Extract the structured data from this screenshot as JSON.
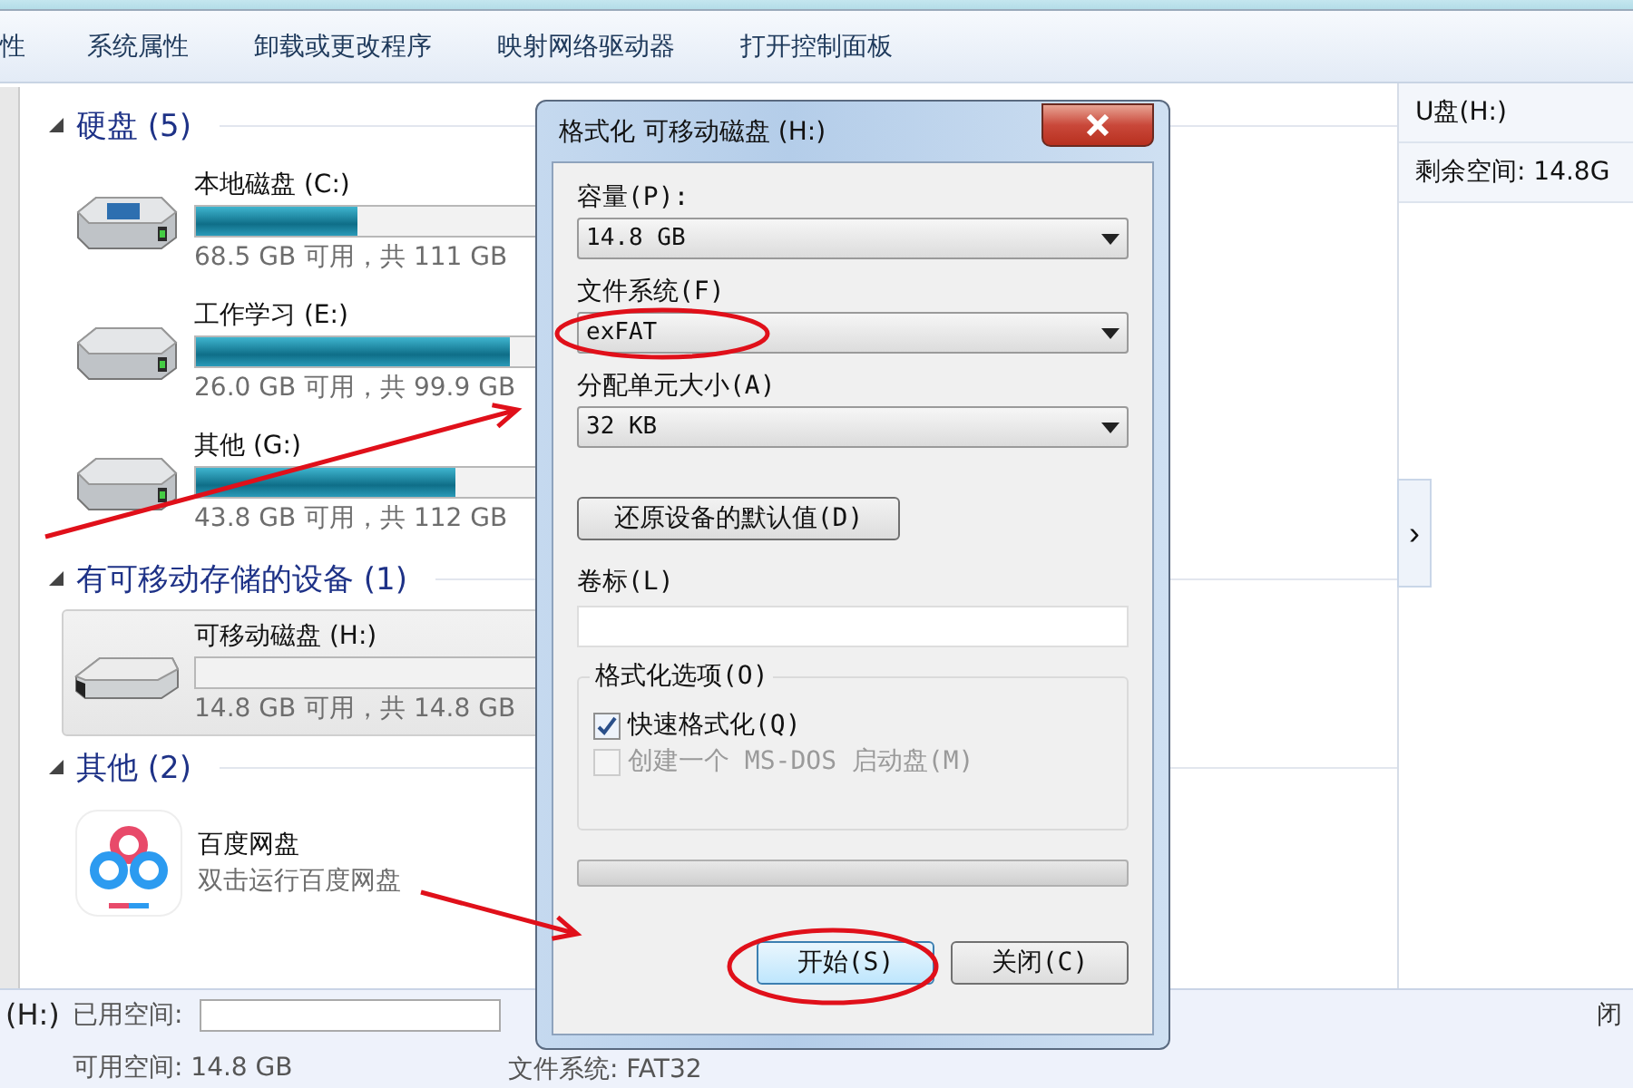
{
  "toolbar": {
    "items": [
      "性",
      "系统属性",
      "卸载或更改程序",
      "映射网络驱动器",
      "打开控制面板"
    ]
  },
  "sections": [
    {
      "title": "硬盘 (5)",
      "expanded": true,
      "items": [
        {
          "kind": "system_drive",
          "name": "本地磁盘 (C:)",
          "level": 0.38,
          "reading": "68.5 GB 可用，共 111 GB",
          "selected": false
        },
        {
          "kind": "drive",
          "name": "工作学习 (E:)",
          "level": 0.74,
          "reading": "26.0 GB 可用，共 99.9 GB",
          "selected": false
        },
        {
          "kind": "drive",
          "name": "其他 (G:)",
          "level": 0.61,
          "reading": "43.8 GB 可用，共 112 GB",
          "selected": false
        }
      ]
    },
    {
      "title": "有可移动存储的设备 (1)",
      "expanded": true,
      "items": [
        {
          "kind": "removable_drive",
          "name": "可移动磁盘 (H:)",
          "level": 0,
          "reading": "14.8 GB 可用，共 14.8 GB",
          "selected": true
        }
      ]
    },
    {
      "title": "其他 (2)",
      "expanded": true,
      "items": [
        {
          "kind": "app",
          "name": "百度网盘",
          "reading": "双击运行百度网盘",
          "selected": false
        }
      ]
    }
  ],
  "details_pane": {
    "title": "U盘(H:)",
    "free": "剩余空间: 14.8G",
    "expand": "›"
  },
  "status_bar": {
    "drive": "(H:)",
    "used_label": "已用空间:",
    "free": "可用空间: 14.8 GB",
    "filesystem": "文件系统: FAT32",
    "partial": "闭"
  },
  "dialog": {
    "title": "格式化 可移动磁盘 (H:)",
    "fields": [
      {
        "label": "容量(P):",
        "value": "14.8 GB"
      },
      {
        "label": "文件系统(F)",
        "value": "exFAT"
      },
      {
        "label": "分配单元大小(A)",
        "value": "32 KB"
      }
    ],
    "restore_button": "还原设备的默认值(D)",
    "volume_label": {
      "label": "卷标(L)"
    },
    "options": {
      "title": "格式化选项(O)",
      "items": [
        {
          "label": "快速格式化(Q)",
          "checked": true,
          "disabled": false
        },
        {
          "label": "创建一个 MS-DOS 启动盘(M)",
          "checked": false,
          "disabled": true
        }
      ]
    },
    "progress": {
      "level": 0
    },
    "buttons": [
      {
        "label": "开始(S)",
        "selected": true
      },
      {
        "label": "关闭(C)",
        "selected": false
      }
    ]
  },
  "annotations": [
    {
      "kind": "arrow"
    },
    {
      "kind": "arrow"
    },
    {
      "kind": "ellipse"
    },
    {
      "kind": "ellipse"
    }
  ]
}
